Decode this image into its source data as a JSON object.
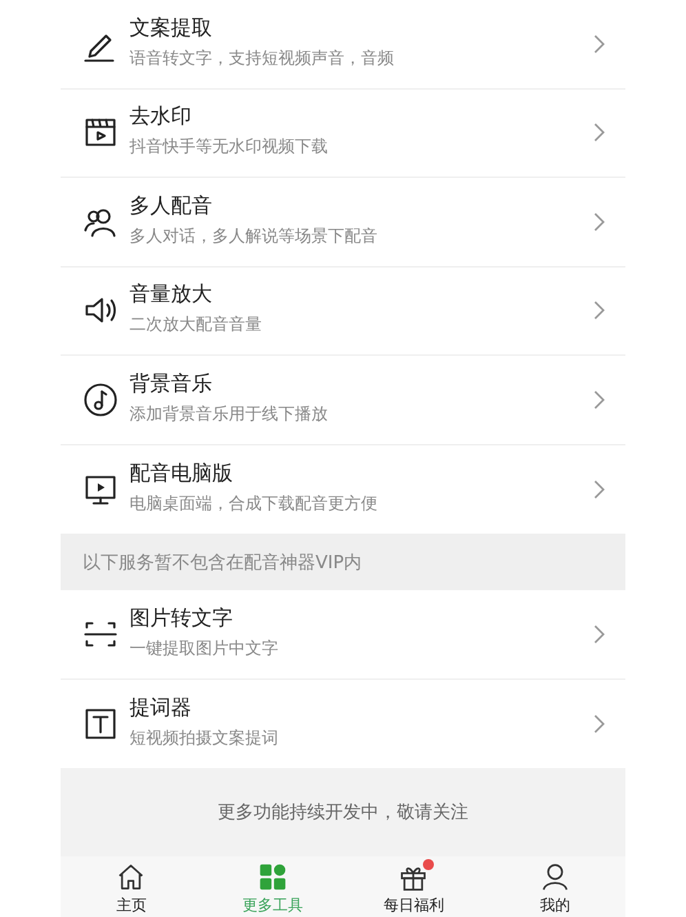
{
  "tools": [
    {
      "title": "文案提取",
      "subtitle": "语音转文字，支持短视频声音，音频"
    },
    {
      "title": "去水印",
      "subtitle": "抖音快手等无水印视频下载"
    },
    {
      "title": "多人配音",
      "subtitle": "多人对话，多人解说等场景下配音"
    },
    {
      "title": "音量放大",
      "subtitle": "二次放大配音音量"
    },
    {
      "title": "背景音乐",
      "subtitle": "添加背景音乐用于线下播放"
    },
    {
      "title": "配音电脑版",
      "subtitle": "电脑桌面端，合成下载配音更方便"
    }
  ],
  "section_header": "以下服务暂不包含在配音神器VIP内",
  "extra_tools": [
    {
      "title": "图片转文字",
      "subtitle": "一键提取图片中文字"
    },
    {
      "title": "提词器",
      "subtitle": "短视频拍摄文案提词"
    }
  ],
  "footer_note": "更多功能持续开发中，敬请关注",
  "tab_bar": [
    {
      "label": "主页",
      "selected": false,
      "badge": false
    },
    {
      "label": "更多工具",
      "selected": true,
      "badge": false
    },
    {
      "label": "每日福利",
      "selected": false,
      "badge": true
    },
    {
      "label": "我的",
      "selected": false,
      "badge": false
    }
  ]
}
